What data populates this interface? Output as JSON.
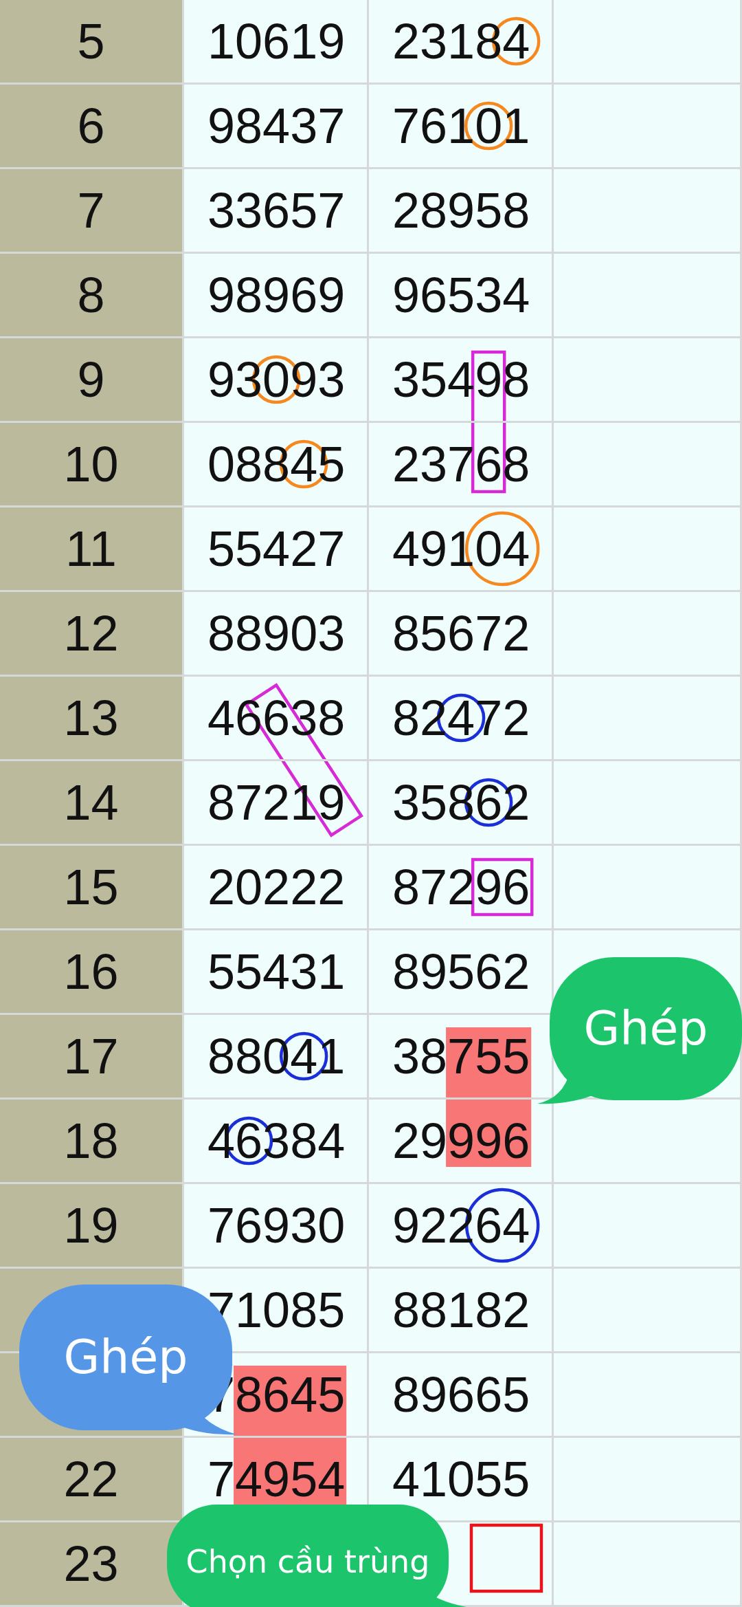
{
  "rows": [
    {
      "label": "5",
      "column_b": "10619",
      "column_c": "23184"
    },
    {
      "label": "6",
      "column_b": "98437",
      "column_c": "76101"
    },
    {
      "label": "7",
      "column_b": "33657",
      "column_c": "28958"
    },
    {
      "label": "8",
      "column_b": "98969",
      "column_c": "96534"
    },
    {
      "label": "9",
      "column_b": "93093",
      "column_c": "35498"
    },
    {
      "label": "10",
      "column_b": "08845",
      "column_c": "23768"
    },
    {
      "label": "11",
      "column_b": "55427",
      "column_c": "49104"
    },
    {
      "label": "12",
      "column_b": "88903",
      "column_c": "85672"
    },
    {
      "label": "13",
      "column_b": "46638",
      "column_c": "82472"
    },
    {
      "label": "14",
      "column_b": "87219",
      "column_c": "35862"
    },
    {
      "label": "15",
      "column_b": "20222",
      "column_c": "87296"
    },
    {
      "label": "16",
      "column_b": "55431",
      "column_c": "89562"
    },
    {
      "label": "17",
      "column_b": "88041",
      "column_c": "38755"
    },
    {
      "label": "18",
      "column_b": "46384",
      "column_c": "29996"
    },
    {
      "label": "19",
      "column_b": "76930",
      "column_c": "92264"
    },
    {
      "column_b": "71085",
      "column_c": "88182"
    },
    {
      "column_b": "78645",
      "column_c": "89665"
    },
    {
      "label": "22",
      "column_b": "74954",
      "column_c": "41055"
    },
    {
      "label": "23"
    }
  ],
  "marks": [
    {
      "kind": "circle",
      "color": "#f5891f"
    },
    {
      "kind": "circle",
      "color": "#f5891f"
    },
    {
      "kind": "circle",
      "color": "#f5891f"
    },
    {
      "kind": "circle",
      "color": "#f5891f"
    },
    {
      "kind": "circle",
      "color": "#f5891f"
    },
    {
      "kind": "rect",
      "color": "#d62ad6"
    },
    {
      "kind": "slant",
      "color": "#d62ad6"
    },
    {
      "kind": "circle",
      "color": "#1a2fd8"
    },
    {
      "kind": "circle",
      "color": "#1a2fd8"
    },
    {
      "kind": "rect",
      "color": "#d62ad6"
    },
    {
      "kind": "circle",
      "color": "#1a2fd8"
    },
    {
      "kind": "circle",
      "color": "#1a2fd8"
    },
    {
      "kind": "fill",
      "color": "#f87676"
    },
    {
      "kind": "circle",
      "color": "#1a2fd8"
    },
    {
      "kind": "fill",
      "color": "#f87676"
    },
    {
      "kind": "box",
      "color": "#e8141c"
    }
  ],
  "bubbles": [
    {
      "text": "Ghép",
      "color": "#1cc46c"
    },
    {
      "text": "Ghép",
      "color": "#5597e6"
    },
    {
      "text": "Chọn cầu trùng",
      "color": "#1cc46c"
    }
  ]
}
